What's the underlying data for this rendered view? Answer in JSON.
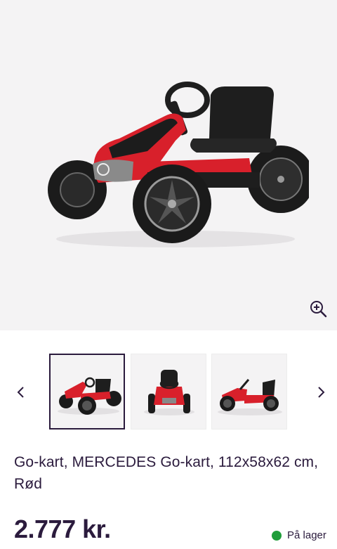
{
  "product": {
    "title": "Go-kart, MERCEDES Go-kart, 112x58x62 cm, Rød",
    "price": "2.777 kr.",
    "stock_status": "På lager",
    "stock_color": "#1f9d3a"
  },
  "gallery": {
    "zoom_icon": "zoom-in-icon",
    "prev_icon": "chevron-left-icon",
    "next_icon": "chevron-right-icon",
    "thumbnails": [
      {
        "view": "angled-side",
        "active": true
      },
      {
        "view": "front",
        "active": false
      },
      {
        "view": "side",
        "active": false
      }
    ]
  },
  "colors": {
    "text": "#2b1b3d",
    "kart_red": "#d8202b",
    "kart_black": "#1c1c1c"
  }
}
